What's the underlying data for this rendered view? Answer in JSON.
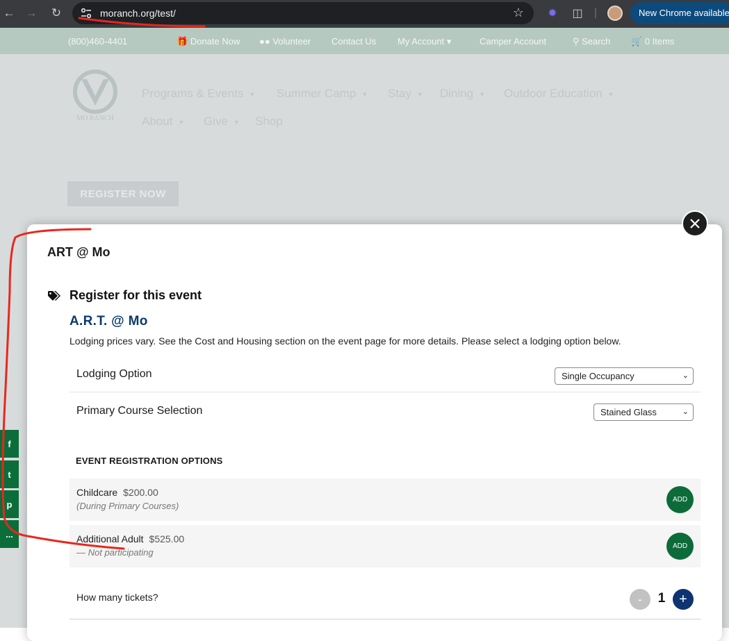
{
  "browser": {
    "url": "moranch.org/test/",
    "update_label": "New Chrome available"
  },
  "site": {
    "topbar": {
      "phone": "(800)460-4401",
      "donate": "Donate Now",
      "volunteer": "Volunteer",
      "contact": "Contact Us",
      "account": "My Account",
      "camper": "Camper Account",
      "search": "Search",
      "cart": "0 Items"
    },
    "logo_text": "MO RANCH",
    "menu": {
      "programs": "Programs & Events",
      "camp": "Summer Camp",
      "stay": "Stay",
      "dining": "Dining",
      "outdoor": "Outdoor Education",
      "about": "About",
      "give": "Give",
      "shop": "Shop"
    },
    "register_now": "REGISTER NOW"
  },
  "modal": {
    "title": "ART @ Mo",
    "register_heading": "Register for this event",
    "event_name": "A.R.T. @ Mo",
    "description": "Lodging prices vary. See the Cost and Housing section on the event page for more details. Please select a lodging option below.",
    "lodging_label": "Lodging Option",
    "lodging_value": "Single Occupancy",
    "course_label": "Primary Course Selection",
    "course_value": "Stained Glass",
    "options_title": "EVENT REGISTRATION OPTIONS",
    "addons": [
      {
        "name": "Childcare",
        "price": "$200.00",
        "note": "(During Primary Courses)",
        "button": "ADD"
      },
      {
        "name": "Additional Adult",
        "price": "$525.00",
        "note": "— Not participating",
        "button": "ADD"
      }
    ],
    "tickets_label": "How many tickets?",
    "tickets_minus": "-",
    "tickets_qty": "1",
    "tickets_plus": "+"
  },
  "share": {
    "facebook": "f",
    "twitter": "t",
    "pinterest": "p",
    "more": "..."
  },
  "colors": {
    "accent_green": "#0d6b3a",
    "accent_navy": "#0d3a6b",
    "annotation_red": "#e8271d"
  }
}
